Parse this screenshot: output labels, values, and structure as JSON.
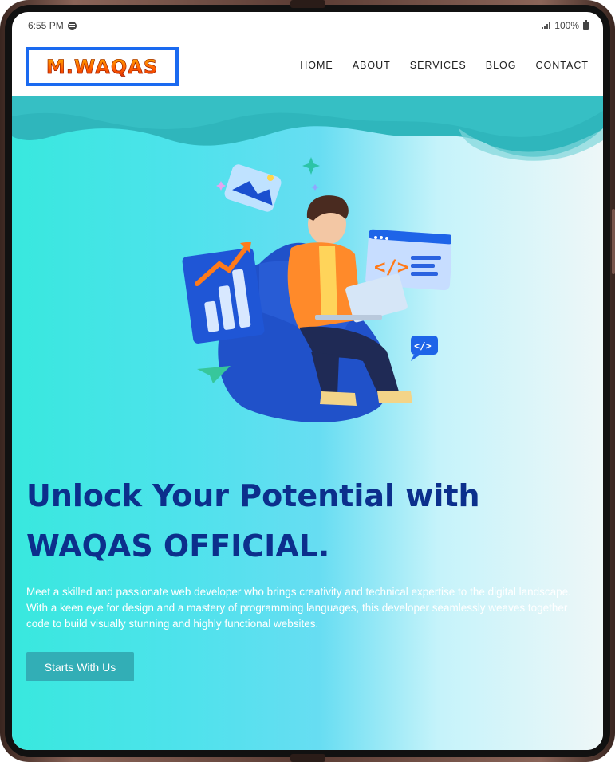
{
  "status_bar": {
    "time": "6:55 PM",
    "battery": "100%",
    "icons": [
      "spotify-icon",
      "signal-icon",
      "battery-icon"
    ]
  },
  "navbar": {
    "logo": "M.WAQAS",
    "links": [
      "HOME",
      "ABOUT",
      "SERVICES",
      "BLOG",
      "CONTACT"
    ]
  },
  "hero": {
    "headline_line1": "Unlock Your Potential with",
    "headline_line2": "WAQAS OFFICIAL.",
    "description": "Meet a skilled and passionate web developer who brings creativity and technical expertise to the digital landscape. With a keen eye for design and a mastery of programming languages, this developer seamlessly weaves together code to build visually stunning and highly functional websites.",
    "cta_label": "Starts With Us"
  },
  "colors": {
    "logo_border": "#1a6af0",
    "headline": "#0c2f8c",
    "cta_background": "#32aeb6",
    "hero_gradient_start": "#38e8de",
    "hero_gradient_end": "#eef7f8"
  }
}
